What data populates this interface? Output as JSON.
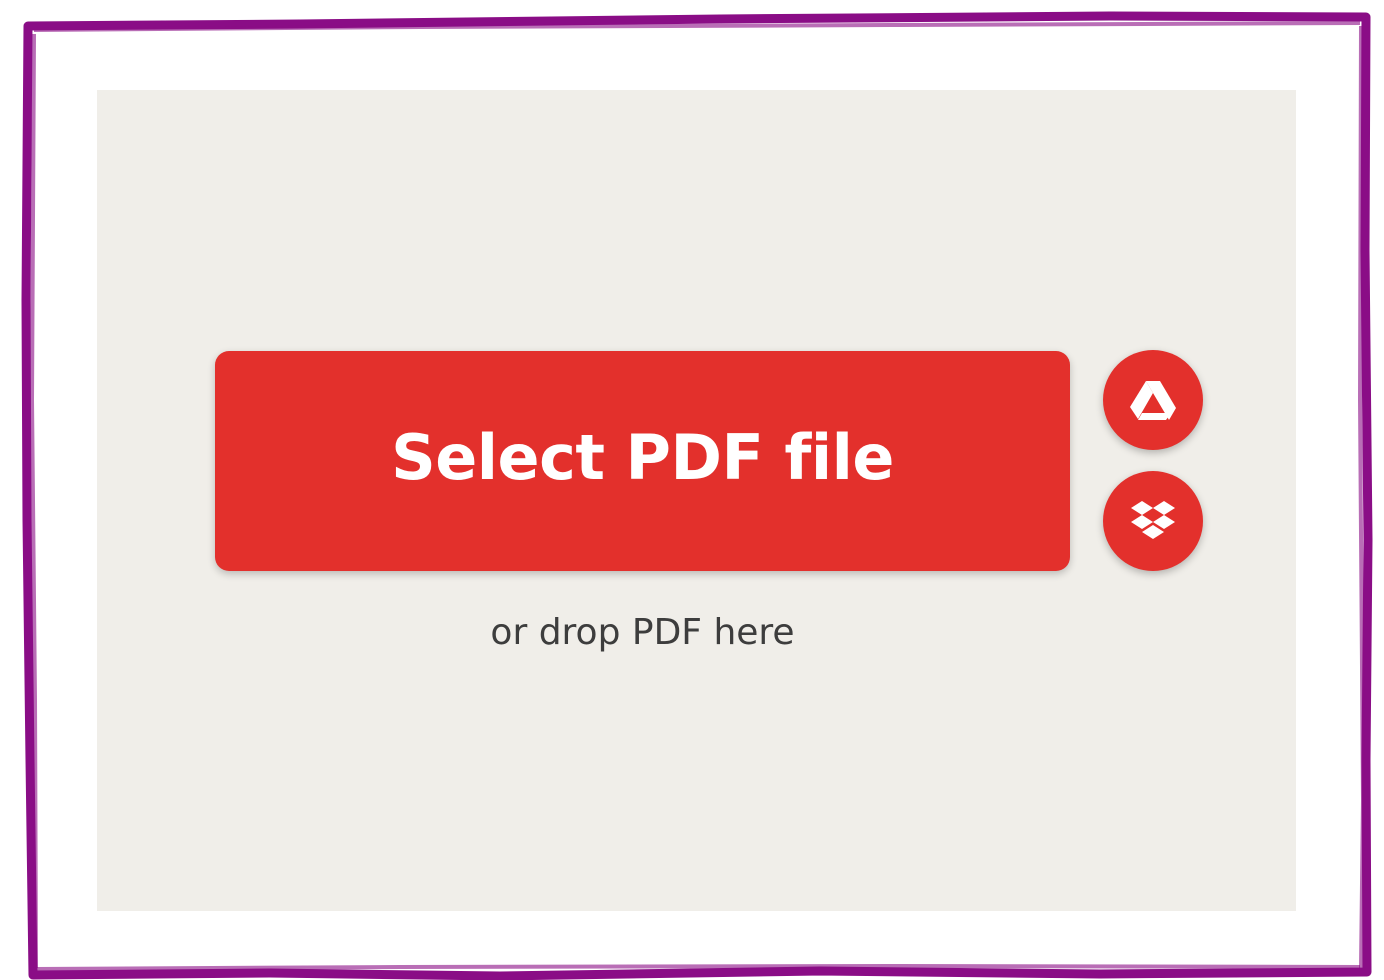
{
  "colors": {
    "frame_border": "#8a0d86",
    "drop_zone_bg": "#f0eee9",
    "accent": "#e3302c",
    "hint_text": "#3d3d3d"
  },
  "upload": {
    "select_label": "Select PDF file",
    "drop_hint": "or drop PDF here",
    "cloud_sources": [
      {
        "icon": "google-drive-icon"
      },
      {
        "icon": "dropbox-icon"
      }
    ]
  }
}
